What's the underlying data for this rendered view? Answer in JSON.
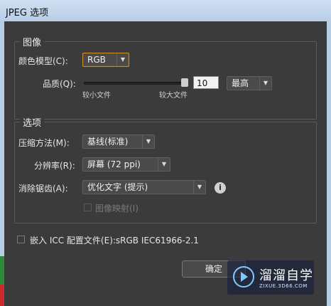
{
  "window": {
    "title": "JPEG 选项"
  },
  "image_group": {
    "legend": "图像",
    "color_model_label": "颜色模型(C):",
    "color_model_value": "RGB",
    "quality_label": "品质(Q):",
    "quality_value": "10",
    "quality_level_value": "最高",
    "slider_min_label": "较小文件",
    "slider_max_label": "较大文件",
    "slider_position": 1.0
  },
  "options_group": {
    "legend": "选项",
    "compression_label": "压缩方法(M):",
    "compression_value": "基线(标准)",
    "resolution_label": "分辨率(R):",
    "resolution_value": "屏幕 (72 ppi)",
    "antialias_label": "消除锯齿(A):",
    "antialias_value": "优化文字 (提示)",
    "image_map_label": "图像映射(I)"
  },
  "embed_icc": {
    "label": "嵌入 ICC 配置文件(E):sRGB IEC61966-2.1"
  },
  "buttons": {
    "ok": "确定"
  },
  "watermark": {
    "brand": "溜溜自学",
    "url": "ZIXUE.3D66.COM"
  },
  "icons": {
    "info": "i"
  }
}
